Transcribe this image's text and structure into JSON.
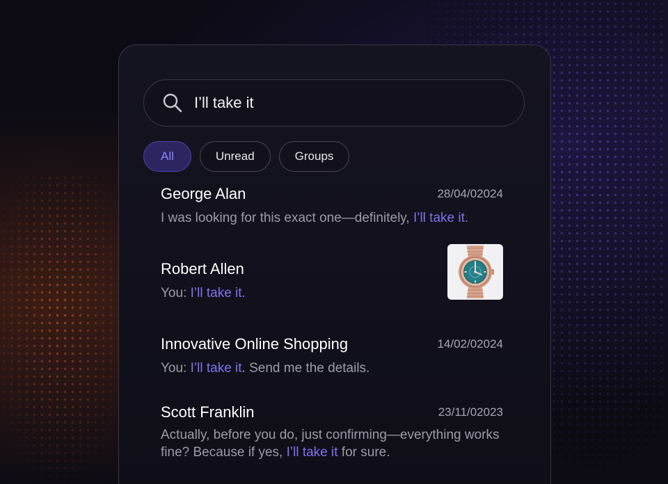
{
  "search": {
    "value": "I’ll take it"
  },
  "filters": [
    {
      "label": "All"
    },
    {
      "label": "Unread"
    },
    {
      "label": "Groups"
    }
  ],
  "messages": [
    {
      "name": "George Alan",
      "date": "28/04/02024",
      "preview_before": "I was looking for this exact one—definitely, ",
      "preview_highlight": "I’ll take it.",
      "preview_after": ""
    },
    {
      "name": "Robert Allen",
      "date": "",
      "preview_before": "You: ",
      "preview_highlight": "I’ll take it.",
      "preview_after": "",
      "thumbnail": "wristwatch-image"
    },
    {
      "name": "Innovative Online Shopping",
      "date": "14/02/02024",
      "preview_before": "You: ",
      "preview_highlight": "I’ll take it",
      "preview_after": ". Send me the details."
    },
    {
      "name": "Scott Franklin",
      "date": "23/11/02023",
      "preview_before": "Actually, before you do, just confirming—everything works fine? Because if yes, ",
      "preview_highlight": "I’ll take it",
      "preview_after": " for sure."
    }
  ],
  "colors": {
    "accent": "#7f74ee",
    "active_chip_bg": "#2b2560",
    "background": "#0c0b14"
  }
}
